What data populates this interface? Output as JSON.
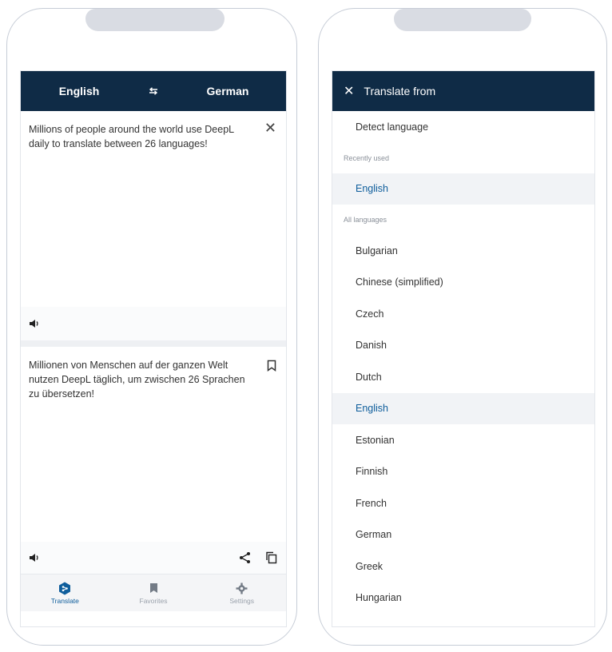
{
  "left": {
    "source_lang": "English",
    "target_lang": "German",
    "swap_icon": "swap-arrows-icon",
    "source_text": "Millions of people around the world use DeepL daily to translate between 26 languages!",
    "target_text": "Millionen von Menschen auf der ganzen Welt nutzen DeepL täglich, um zwischen 26 Sprachen zu übersetzen!",
    "tabs": [
      {
        "label": "Translate",
        "icon": "deepl-logo-icon"
      },
      {
        "label": "Favorites",
        "icon": "bookmark-icon"
      },
      {
        "label": "Settings",
        "icon": "gear-icon"
      }
    ],
    "colors": {
      "header": "#0f2b46",
      "accent": "#0f5e9c"
    }
  },
  "right": {
    "title": "Translate from",
    "detect": "Detect language",
    "recent_label": "Recently used",
    "recent": [
      "English"
    ],
    "all_label": "All languages",
    "languages": [
      "Bulgarian",
      "Chinese (simplified)",
      "Czech",
      "Danish",
      "Dutch",
      "English",
      "Estonian",
      "Finnish",
      "French",
      "German",
      "Greek",
      "Hungarian"
    ],
    "selected": "English"
  }
}
